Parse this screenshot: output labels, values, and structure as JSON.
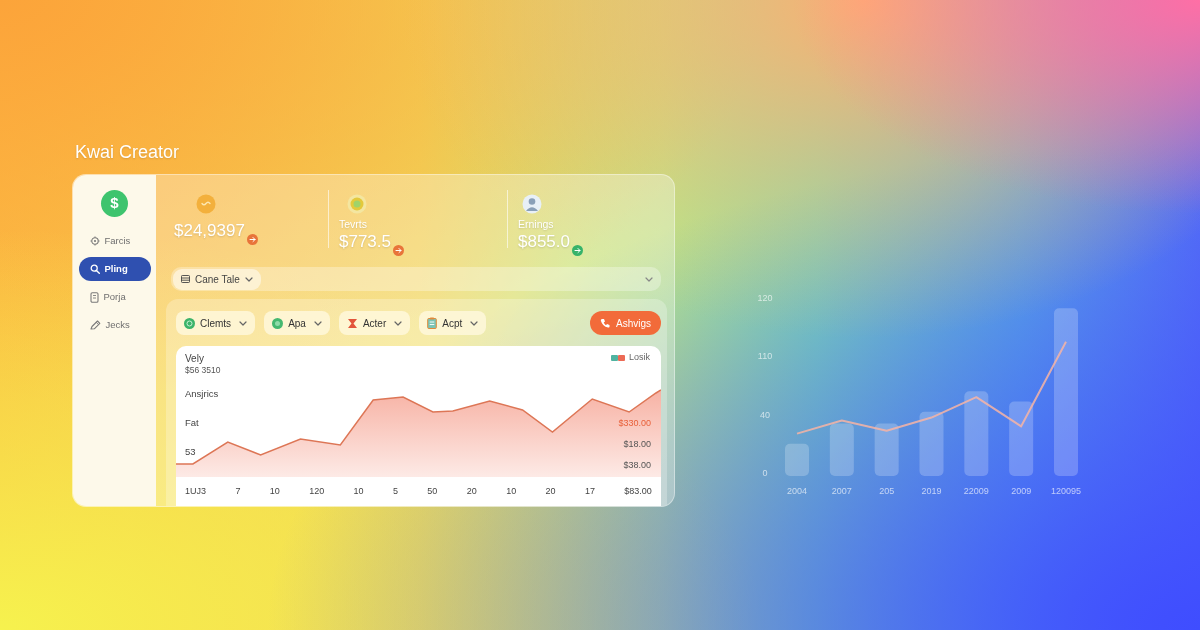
{
  "app_title": "Kwai Creator",
  "sidebar": {
    "logo": "$",
    "items": [
      {
        "label": "Farcis",
        "selected": false
      },
      {
        "label": "Pling",
        "selected": true
      },
      {
        "label": "Porja",
        "selected": false
      },
      {
        "label": "Jecks",
        "selected": false
      }
    ]
  },
  "stats": [
    {
      "value": "$24,9397",
      "color": "#e8743a"
    },
    {
      "label": "Tevrts",
      "value": "$773.5",
      "color": "#e8743a"
    },
    {
      "label": "Ernings",
      "value": "$855.0",
      "color": "#36b36a"
    }
  ],
  "period_select": {
    "value": "Cane Tale"
  },
  "filters": [
    {
      "label": "Clemts"
    },
    {
      "label": "Apa"
    },
    {
      "label": "Acter"
    },
    {
      "label": "Acpt"
    }
  ],
  "action_button": {
    "label": "Ashvigs"
  },
  "chart_card": {
    "title": "Vely",
    "subtitle": "$56 3510",
    "legend": "Losik",
    "left_labels": [
      "Ansjrics",
      "Fat",
      "53"
    ],
    "right_labels": [
      {
        "text": "$330.00",
        "highlighted": true
      },
      {
        "text": "$18.00",
        "highlighted": false
      },
      {
        "text": "$38.00",
        "highlighted": false
      }
    ],
    "x_labels": [
      "1UJ3",
      "7",
      "10",
      "120",
      "10",
      "5",
      "50",
      "20",
      "10",
      "20",
      "17",
      "$83.00"
    ]
  },
  "background_chart": {
    "stray_axis_label": "110",
    "chart_data": {
      "type": "bar",
      "categories": [
        "2004",
        "2007",
        "205",
        "2019",
        "22009",
        "2009",
        "120095"
      ],
      "series": [
        {
          "color": "#ffffff",
          "values": [
            20,
            34,
            34,
            42,
            56,
            49,
            113
          ]
        },
        {
          "type": "line",
          "color": "#f7b4a4",
          "values": [
            27,
            36,
            29,
            38,
            52,
            32,
            90
          ]
        }
      ],
      "ylim": [
        0,
        120
      ],
      "yticks": [
        0,
        40,
        120
      ]
    }
  }
}
